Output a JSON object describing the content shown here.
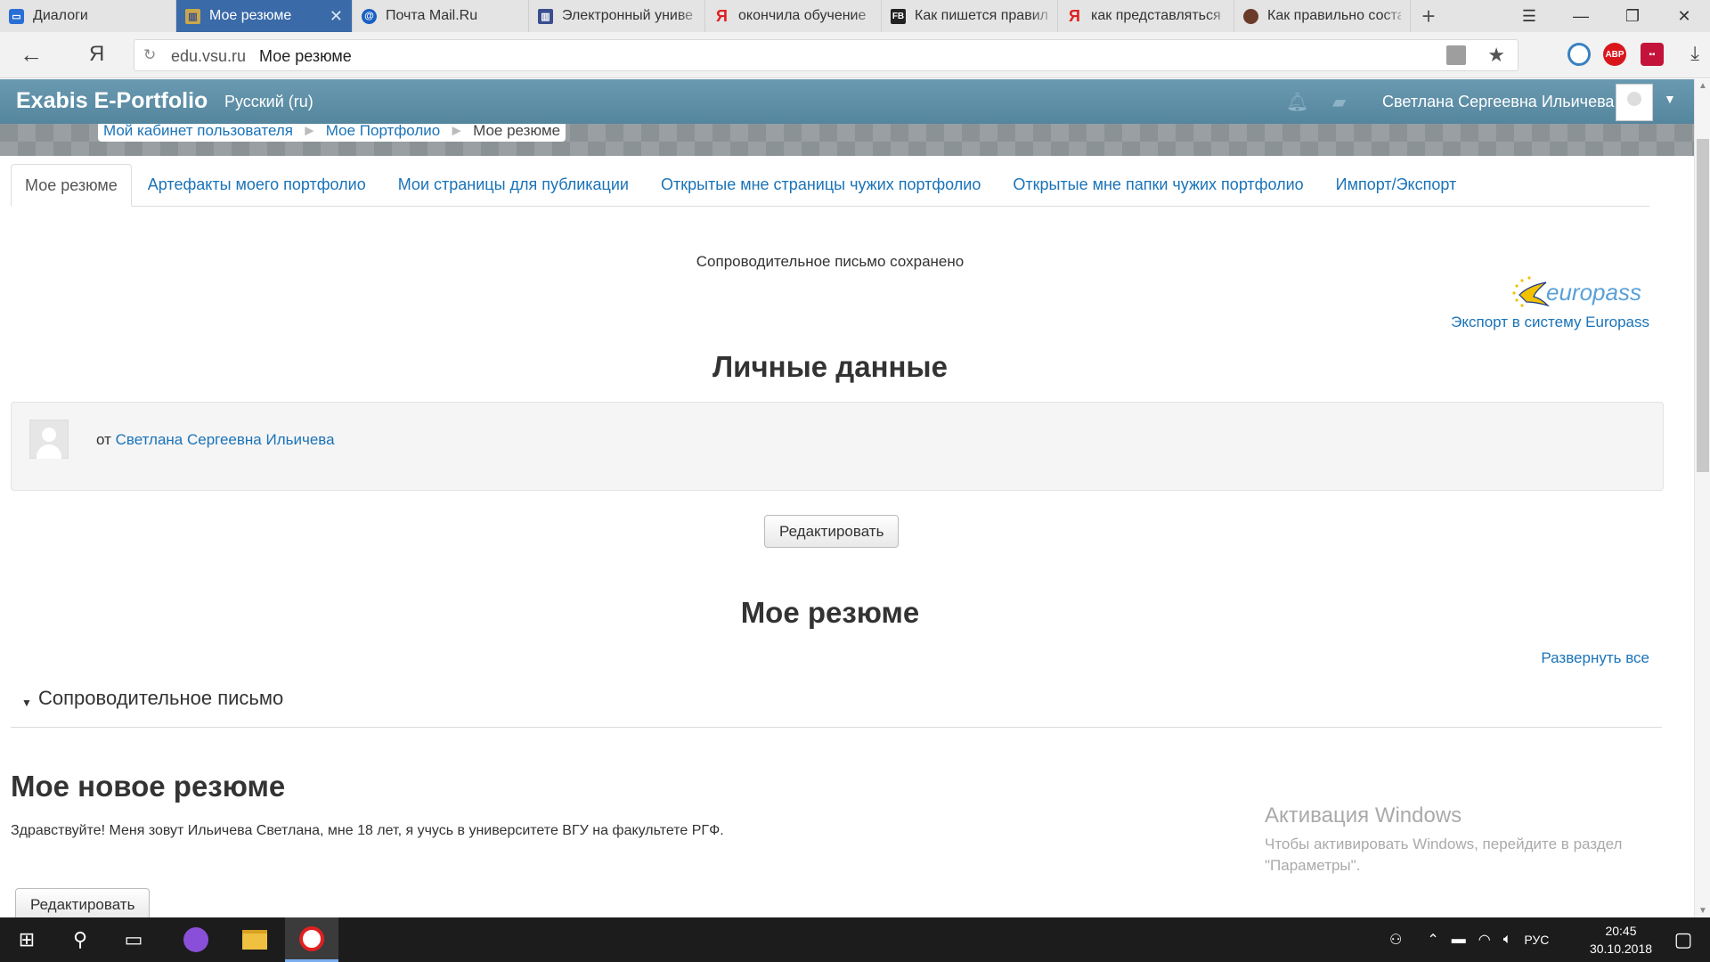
{
  "browser": {
    "tabs": [
      {
        "title": "Диалоги",
        "fav_color": "#2a6fd6",
        "icon": "chat-icon"
      },
      {
        "title": "Мое резюме",
        "fav_color": "#3a4e8f",
        "icon": "vsu-icon",
        "active": true
      },
      {
        "title": "Почта Mail.Ru",
        "fav_color": "#1a5fc4",
        "icon": "mail-icon"
      },
      {
        "title": "Электронный униве",
        "fav_color": "#3a4e8f",
        "icon": "vsu-icon"
      },
      {
        "title": "окончила обучение",
        "fav_color": "#e02020",
        "icon": "yandex-icon"
      },
      {
        "title": "Как пишется правил",
        "fav_color": "#222222",
        "icon": "fb-icon"
      },
      {
        "title": "как представляться в",
        "fav_color": "#e02020",
        "icon": "yandex-icon"
      },
      {
        "title": "Как правильно соста",
        "fav_color": "#6b3b2a",
        "icon": "site-icon"
      }
    ],
    "fav_letters": [
      "",
      "",
      "@",
      "",
      "Я",
      "FB",
      "Я",
      ""
    ],
    "address": {
      "domain": "edu.vsu.ru",
      "page_title": "Мое резюме"
    },
    "extensions": {
      "abp": "ABP"
    }
  },
  "site": {
    "brand": "Exabis E-Portfolio",
    "language": "Русский (ru)",
    "user_name": "Светлана Сергеевна Ильичева",
    "breadcrumb": [
      "Мой кабинет пользователя",
      "Мое Портфолио",
      "Мое резюме"
    ]
  },
  "tabs": [
    {
      "label": "Мое резюме",
      "active": true
    },
    {
      "label": "Артефакты моего портфолио"
    },
    {
      "label": "Мои страницы для публикации"
    },
    {
      "label": "Открытые мне страницы чужих портфолио"
    },
    {
      "label": "Открытые мне папки чужих портфолио"
    },
    {
      "label": "Импорт/Экспорт"
    }
  ],
  "content": {
    "notice": "Сопроводительное письмо сохранено",
    "europass_logo_text": "europass",
    "europass_link": "Экспорт в систему Europass",
    "personal_heading": "Личные данные",
    "by_prefix": "от",
    "author": "Светлана Сергеевна Ильичева",
    "edit_button": "Редактировать",
    "resume_heading": "Мое резюме",
    "expand_all": "Развернуть все",
    "cover_letter_section": "Сопроводительное письмо",
    "new_resume_heading": "Мое новое резюме",
    "greeting": "Здравствуйте! Меня зовут Ильичева Светлана, мне 18 лет, я учусь в университете ВГУ на факультете РГФ.",
    "edit_button_2": "Редактировать"
  },
  "watermark": {
    "title": "Активация Windows",
    "line1": "Чтобы активировать Windows, перейдите в раздел",
    "line2": "\"Параметры\"."
  },
  "taskbar": {
    "language": "РУС",
    "time": "20:45",
    "date": "30.10.2018"
  }
}
